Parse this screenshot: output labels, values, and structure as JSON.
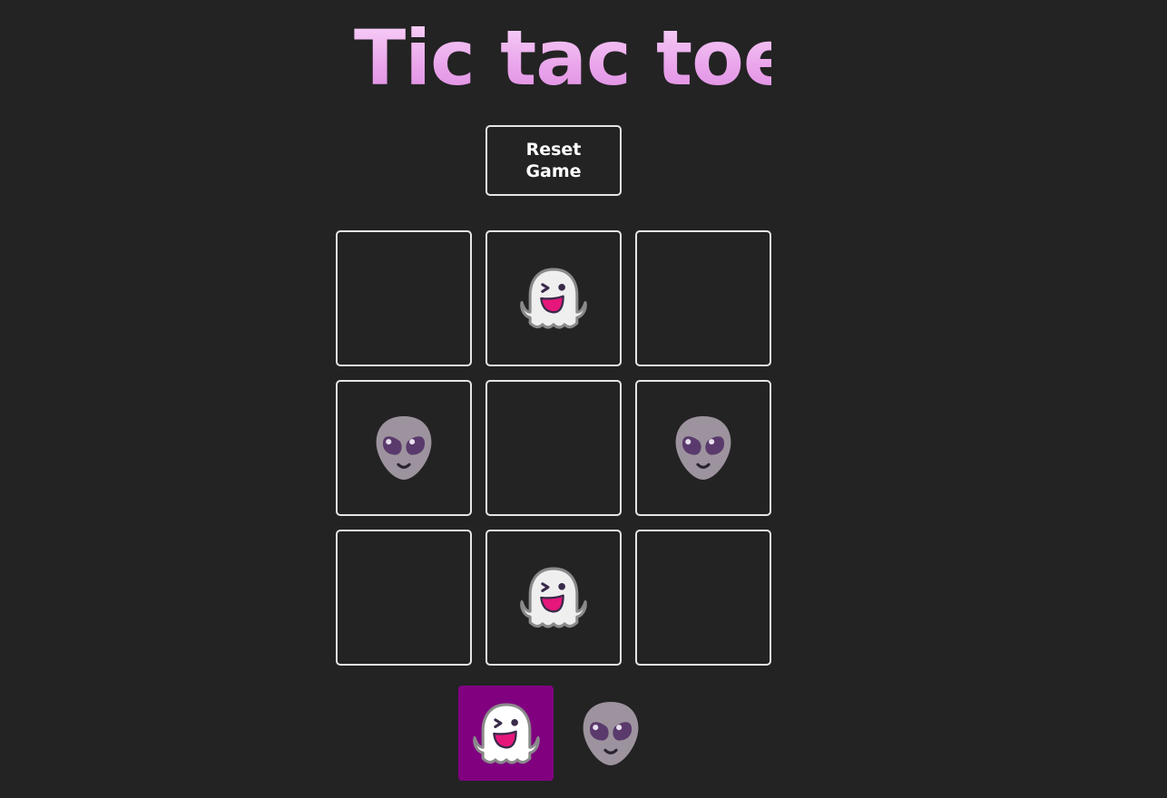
{
  "title": "Tic tac toe",
  "reset_label": "Reset\nGame",
  "board": [
    [
      "empty",
      "ghost",
      "empty"
    ],
    [
      "alien",
      "empty",
      "alien"
    ],
    [
      "empty",
      "ghost",
      "empty"
    ]
  ],
  "icons": {
    "ghost": "ghost-icon",
    "alien": "alien-icon"
  },
  "players": [
    {
      "symbol": "ghost",
      "active": true
    },
    {
      "symbol": "alien",
      "active": false
    }
  ],
  "colors": {
    "background": "#232323",
    "active_player": "#800080",
    "border": "#e6e6e6"
  }
}
